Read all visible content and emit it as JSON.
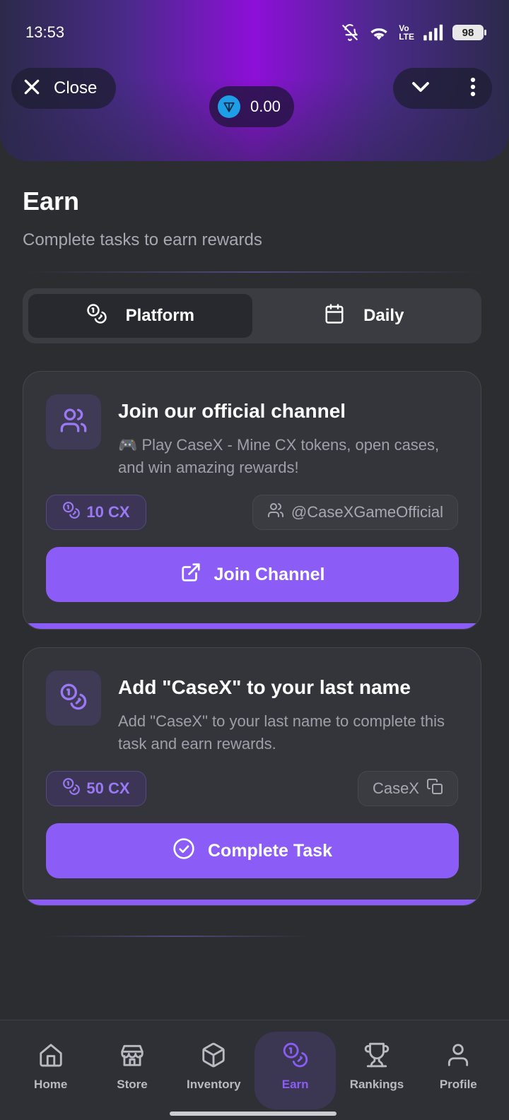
{
  "status_bar": {
    "time": "13:53",
    "battery": "98",
    "icons": [
      "mute-icon",
      "wifi-icon",
      "volte-icon",
      "signal-icon",
      "battery-icon"
    ],
    "volte_top": "Vo",
    "volte_bottom": "LTE"
  },
  "header": {
    "close_label": "Close",
    "balance": "0.00",
    "balance_icon": "ton-icon",
    "colors": {
      "gradient_center": "#8d0fd8",
      "gradient_edge": "#2b2a4a"
    }
  },
  "page": {
    "title": "Earn",
    "subtitle": "Complete tasks to earn rewards"
  },
  "tabs": [
    {
      "label": "Platform",
      "icon": "coins-icon",
      "active": true
    },
    {
      "label": "Daily",
      "icon": "calendar-icon",
      "active": false
    }
  ],
  "tasks": [
    {
      "icon": "users-icon",
      "title": "Join our official channel",
      "description": "🎮 Play CaseX - Mine CX tokens, open cases, and win amazing rewards!",
      "reward": "10 CX",
      "target": "@CaseXGameOfficial",
      "target_icon": "users-icon",
      "action_label": "Join Channel",
      "action_icon": "external-link-icon"
    },
    {
      "icon": "coins-icon",
      "title": "Add \"CaseX\" to your last name",
      "description": "Add \"CaseX\" to your last name to complete this task and earn rewards.",
      "reward": "50 CX",
      "target": "CaseX",
      "target_icon": "copy-icon",
      "action_label": "Complete Task",
      "action_icon": "check-circle-icon"
    }
  ],
  "bottom_nav": [
    {
      "label": "Home",
      "icon": "home-icon",
      "active": false
    },
    {
      "label": "Store",
      "icon": "store-icon",
      "active": false
    },
    {
      "label": "Inventory",
      "icon": "box-icon",
      "active": false
    },
    {
      "label": "Earn",
      "icon": "coins-icon",
      "active": true
    },
    {
      "label": "Rankings",
      "icon": "trophy-icon",
      "active": false
    },
    {
      "label": "Profile",
      "icon": "user-icon",
      "active": false
    }
  ],
  "colors": {
    "accent": "#8b5cf6",
    "background": "#2b2d31",
    "card": "#33353b",
    "muted_text": "#a6a9b2"
  }
}
